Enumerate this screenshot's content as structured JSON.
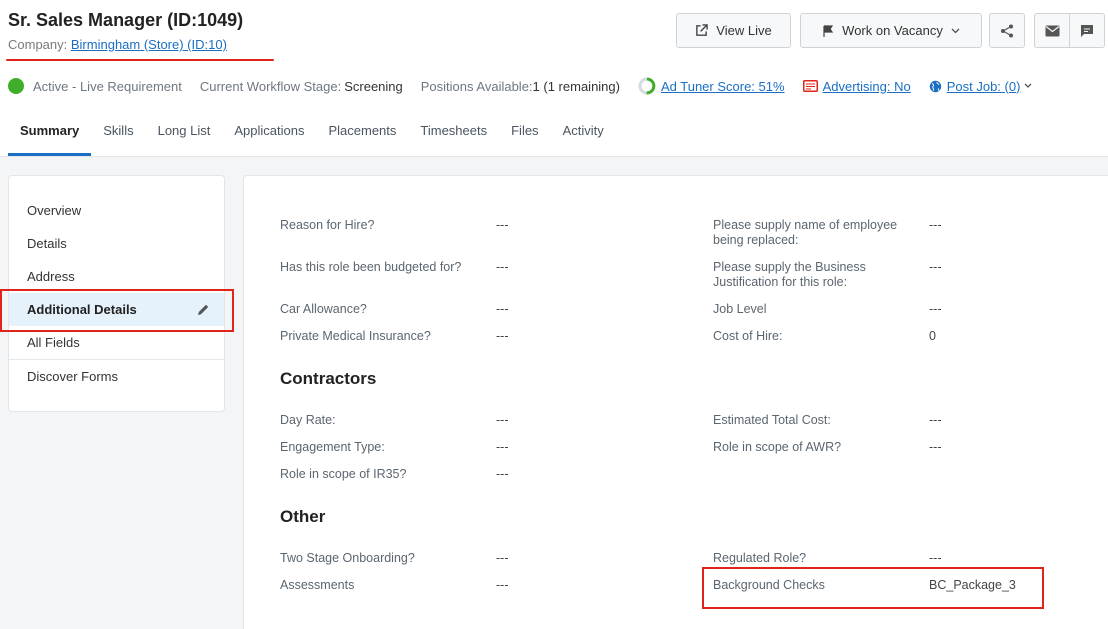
{
  "header": {
    "title": "Sr. Sales Manager (ID:1049)",
    "company_label": "Company:",
    "company_link": "Birmingham (Store) (ID:10)",
    "buttons": {
      "view_live": "View Live",
      "work_on_vacancy": "Work on Vacancy"
    }
  },
  "status": {
    "state": "Active - Live Requirement",
    "workflow_label": "Current Workflow Stage:",
    "workflow_value": "Screening",
    "positions_label": "Positions Available:",
    "positions_value": "1 (1 remaining)",
    "ad_tuner": "Ad Tuner Score: 51%",
    "advertising": "Advertising: No",
    "post_job": "Post Job: (0)",
    "status_color": "#3fae2a"
  },
  "tabs": [
    "Summary",
    "Skills",
    "Long List",
    "Applications",
    "Placements",
    "Timesheets",
    "Files",
    "Activity"
  ],
  "sidenav": {
    "items": [
      "Overview",
      "Details",
      "Address",
      "Additional Details",
      "All Fields",
      "Discover Forms"
    ],
    "active": "Additional Details"
  },
  "fields": {
    "reason_for_hire": {
      "label": "Reason for Hire?",
      "value": "---"
    },
    "budgeted": {
      "label": "Has this role been budgeted for?",
      "value": "---"
    },
    "car_allowance": {
      "label": "Car Allowance?",
      "value": "---"
    },
    "private_medical": {
      "label": "Private Medical Insurance?",
      "value": "---"
    },
    "employee_replaced": {
      "label1": "Please supply name of employee",
      "label2": "being replaced:",
      "value": "---"
    },
    "business_justification": {
      "label1": "Please supply the Business",
      "label2": "Justification for this role:",
      "value": "---"
    },
    "job_level": {
      "label": "Job Level",
      "value": "---"
    },
    "cost_of_hire": {
      "label": "Cost of Hire:",
      "value": "0"
    },
    "contractors_title": "Contractors",
    "day_rate": {
      "label": "Day Rate:",
      "value": "---"
    },
    "engagement_type": {
      "label": "Engagement Type:",
      "value": "---"
    },
    "ir35": {
      "label": "Role in scope of IR35?",
      "value": "---"
    },
    "estimated_total_cost": {
      "label": "Estimated Total Cost:",
      "value": "---"
    },
    "awr": {
      "label": "Role in scope of AWR?",
      "value": "---"
    },
    "other_title": "Other",
    "two_stage": {
      "label": "Two Stage Onboarding?",
      "value": "---"
    },
    "assessments": {
      "label": "Assessments",
      "value": "---"
    },
    "regulated_role": {
      "label": "Regulated Role?",
      "value": "---"
    },
    "background_checks": {
      "label": "Background Checks",
      "value": "BC_Package_3"
    }
  },
  "colors": {
    "accent": "#1a6fc4",
    "highlight": "#e0241b",
    "active_bg": "#e5f1fb"
  }
}
